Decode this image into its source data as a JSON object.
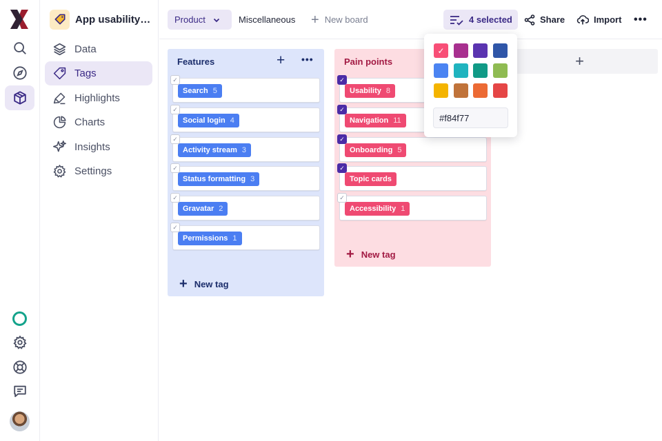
{
  "sidebar": {
    "project_name": "App usability t...",
    "items": [
      {
        "label": "Data"
      },
      {
        "label": "Tags"
      },
      {
        "label": "Highlights"
      },
      {
        "label": "Charts"
      },
      {
        "label": "Insights"
      },
      {
        "label": "Settings"
      }
    ],
    "active_item": "Tags"
  },
  "topbar": {
    "tabs": [
      {
        "label": "Product",
        "active": true
      },
      {
        "label": "Miscellaneous",
        "active": false
      }
    ],
    "new_board_label": "New board",
    "selected_label": "4 selected",
    "share_label": "Share",
    "import_label": "Import",
    "more_label": "•••"
  },
  "board": {
    "columns": [
      {
        "title": "Features",
        "new_tag_label": "New tag",
        "tags": [
          {
            "label": "Search",
            "count": "5",
            "checked": false
          },
          {
            "label": "Social login",
            "count": "4",
            "checked": false
          },
          {
            "label": "Activity stream",
            "count": "3",
            "checked": false
          },
          {
            "label": "Status formatting",
            "count": "3",
            "checked": false
          },
          {
            "label": "Gravatar",
            "count": "2",
            "checked": false
          },
          {
            "label": "Permissions",
            "count": "1",
            "checked": false
          }
        ]
      },
      {
        "title": "Pain points",
        "new_tag_label": "New tag",
        "tags": [
          {
            "label": "Usability",
            "count": "8",
            "checked": true
          },
          {
            "label": "Navigation",
            "count": "11",
            "checked": true
          },
          {
            "label": "Onboarding",
            "count": "5",
            "checked": true
          },
          {
            "label": "Topic cards",
            "count": "",
            "checked": true
          },
          {
            "label": "Accessibility",
            "count": "1",
            "checked": false
          }
        ]
      }
    ]
  },
  "color_picker": {
    "swatches": [
      "#f84f77",
      "#a8308f",
      "#5a34b0",
      "#2f56a8",
      "#4b84f2",
      "#20b4bf",
      "#119a86",
      "#8fbb52",
      "#f4b400",
      "#c0733a",
      "#ec6a34",
      "#e54646"
    ],
    "selected": "#f84f77",
    "hex_value": "#f84f77"
  },
  "colors": {
    "accent": "#4b2ca6",
    "features_bg": "#dde5fb",
    "pain_bg": "#fddde2",
    "blue_chip": "#4b7ef2",
    "red_chip": "#ef4a72"
  }
}
